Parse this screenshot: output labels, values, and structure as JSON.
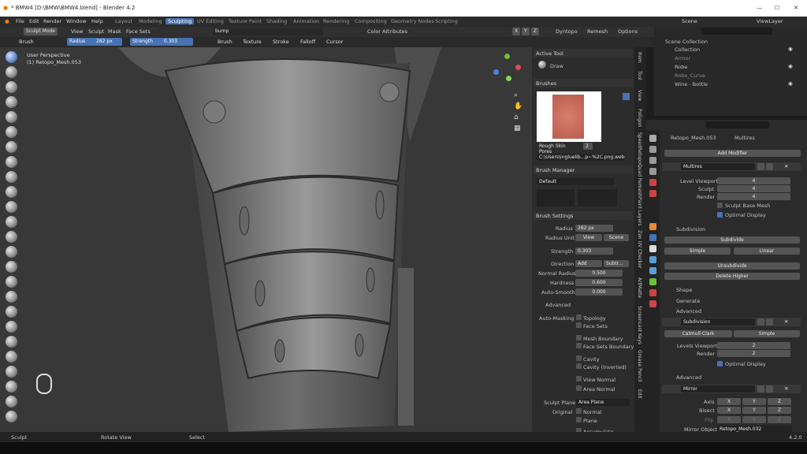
{
  "window": {
    "title": "* BMW4 [D:\\BMW\\BMW4.blend] - Blender 4.2",
    "controls": [
      "—",
      "☐",
      "✕"
    ]
  },
  "menu": [
    "File",
    "Edit",
    "Render",
    "Window",
    "Help"
  ],
  "workspaces": [
    "Layout",
    "Modeling",
    "Sculpting",
    "UV Editing",
    "Texture Paint",
    "Shading",
    "Animation",
    "Rendering",
    "Compositing",
    "Geometry Nodes",
    "Scripting"
  ],
  "active_workspace": "Sculpting",
  "scene": {
    "label": "Scene",
    "view_layer": "ViewLayer"
  },
  "header": {
    "mode": "Sculpt Mode",
    "view": "View",
    "sculpt": "Sculpt",
    "mask": "Mask",
    "face_sets": "Face Sets",
    "search": "bump",
    "xyz": [
      "X",
      "Y",
      "Z"
    ],
    "dyntopo": "Dyntopo",
    "remesh": "Remesh",
    "options": "Options",
    "color_attributes": "Color Attributes"
  },
  "toolheader": {
    "brush": "Brush",
    "radius_label": "Radius",
    "radius_value": "282 px",
    "strength_label": "Strength",
    "strength_value": "0.303",
    "texture": "Texture",
    "stroke": "Stroke",
    "falloff": "Falloff",
    "cursor": "Cursor"
  },
  "viewport": {
    "perspective": "User Perspective",
    "object": "(1) Retopo_Mesh.053"
  },
  "tools_panel": {
    "active_tool": "Active Tool",
    "draw": "Draw",
    "brushes": "Brushes",
    "brush_name": "Rough Skin Pores",
    "brush_users": "2",
    "brush_path": "C:\\Users\\ingluelib...p~%2C.png.webp",
    "brush_manager": "Brush Manager",
    "manager_default": "Default",
    "brush_settings": "Brush Settings",
    "radius": "Radius",
    "radius_val": "282 px",
    "radius_unit": "Radius Unit",
    "view": "View",
    "scene": "Scene",
    "strength": "Strength",
    "strength_val": "0.303",
    "direction": "Direction",
    "add": "Add",
    "subtract": "Subtr...",
    "normal_radius": "Normal Radius",
    "normal_radius_val": "0.500",
    "hardness": "Hardness",
    "hardness_val": "0.600",
    "auto_smooth": "Auto-Smooth",
    "auto_smooth_val": "0.000",
    "advanced": "Advanced",
    "auto_masking": "Auto-Masking",
    "topology": "Topology",
    "face_sets": "Face Sets",
    "mesh_boundary": "Mesh Boundary",
    "face_sets_boundary": "Face Sets Boundary",
    "cavity": "Cavity",
    "cavity_inv": "Cavity (Inverted)",
    "view_normal": "View Normal",
    "area_normal": "Area Normal",
    "sculpt_plane": "Sculpt Plane",
    "area_plane": "Area Plane",
    "original": "Original",
    "normal": "Normal",
    "plane": "Plane",
    "accumulate": "Accumulate"
  },
  "side_tabs": [
    "Item",
    "Tool",
    "View",
    "Poliigon",
    "SpeedRetopo",
    "Quad Remesh",
    "Paint Layers",
    "Zen UV Checker",
    "ArtMatte",
    "Screencast Keys",
    "Grease Pencil",
    "Edit"
  ],
  "outliner": {
    "search": "",
    "items": [
      "Scene Collection",
      "Collection",
      "Armor",
      "Robe",
      "Robe_Curve",
      "Wine - Bottle"
    ]
  },
  "properties": {
    "object": "Retopo_Mesh.053",
    "modifier_tab": "Multires",
    "add_modifier": "Add Modifier",
    "multires": {
      "name": "Multires",
      "level_viewport": "Level Viewport",
      "sculpt": "Sculpt",
      "render": "Render",
      "lv": "4",
      "sc": "4",
      "rn": "4",
      "sculpt_base_mesh": "Sculpt Base Mesh",
      "optimal_display": "Optimal Display",
      "subdivision": "Subdivision",
      "subdivide": "Subdivide",
      "simple": "Simple",
      "linear": "Linear",
      "unsubdivide": "Unsubdivide",
      "delete_higher": "Delete Higher",
      "shape": "Shape",
      "generate": "Generate",
      "advanced": "Advanced"
    },
    "subsurf": {
      "name": "Subdivision",
      "catmull": "Catmull-Clark",
      "simple": "Simple",
      "levels_viewport": "Levels Viewport",
      "render": "Render",
      "lv": "2",
      "rn": "2",
      "optimal_display": "Optimal Display",
      "advanced": "Advanced"
    },
    "mirror": {
      "name": "Mirror",
      "axis": "Axis",
      "bisect": "Bisect",
      "flip": "Flip",
      "x": "X",
      "y": "Y",
      "z": "Z",
      "mirror_object": "Mirror Object",
      "mirror_object_val": "Retopo_Mesh.032"
    }
  },
  "status": {
    "left": "Sculpt",
    "mid": "Rotate View",
    "right": "Select",
    "version": "4.2.0"
  },
  "colors": {
    "accent": "#4772b3",
    "bg": "#1d1d1d",
    "panel": "#2c2c2c"
  }
}
